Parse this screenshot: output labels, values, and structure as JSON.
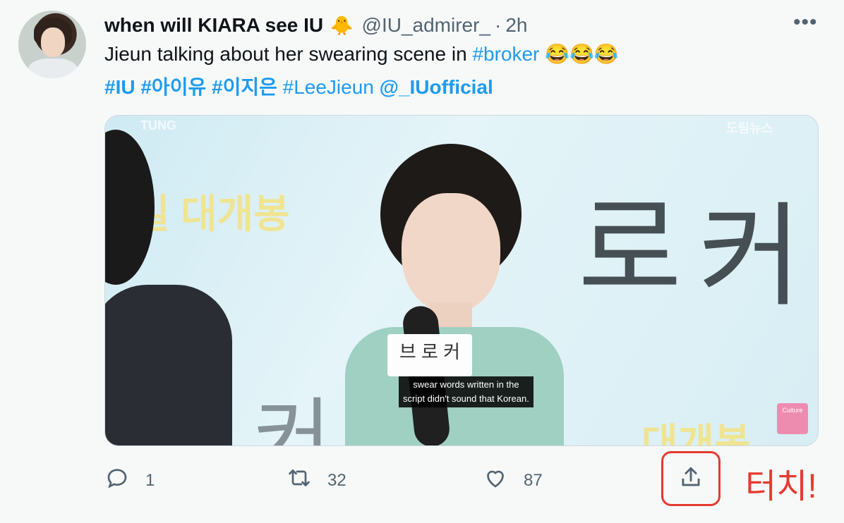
{
  "tweet": {
    "display_name": "when will KIARA see IU",
    "name_emoji": "🐥",
    "handle": "@IU_admirer_",
    "separator": "·",
    "time": "2h",
    "more": "•••",
    "text_line1_prefix": "Jieun talking about her swearing scene in ",
    "text_line1_link": "#broker",
    "text_line1_emojis": "😂😂😂",
    "hashtags": [
      "#IU",
      "#아이유",
      "#이지은",
      "#LeeJieun"
    ],
    "mention": "@_IUofficial"
  },
  "media": {
    "subtitle_line1": "swear words written in the",
    "subtitle_line2": "script didn't sound that Korean.",
    "bg_text_top": "밀 대개봉",
    "bg_text_bottom": "대개봉",
    "bg_title_1": "로",
    "bg_title_2": "커",
    "bg_title_3": "커",
    "card_text": "브 로 커",
    "watermark_left": "TUNG",
    "watermark_right": "도림뉴스",
    "badge_text": "Culture"
  },
  "actions": {
    "reply_count": "1",
    "retweet_count": "32",
    "like_count": "87"
  },
  "annotation": {
    "touch_label": "터치!",
    "highlight_color": "#e53a2f"
  },
  "colors": {
    "link": "#1d9bf0",
    "secondary": "#536471"
  }
}
